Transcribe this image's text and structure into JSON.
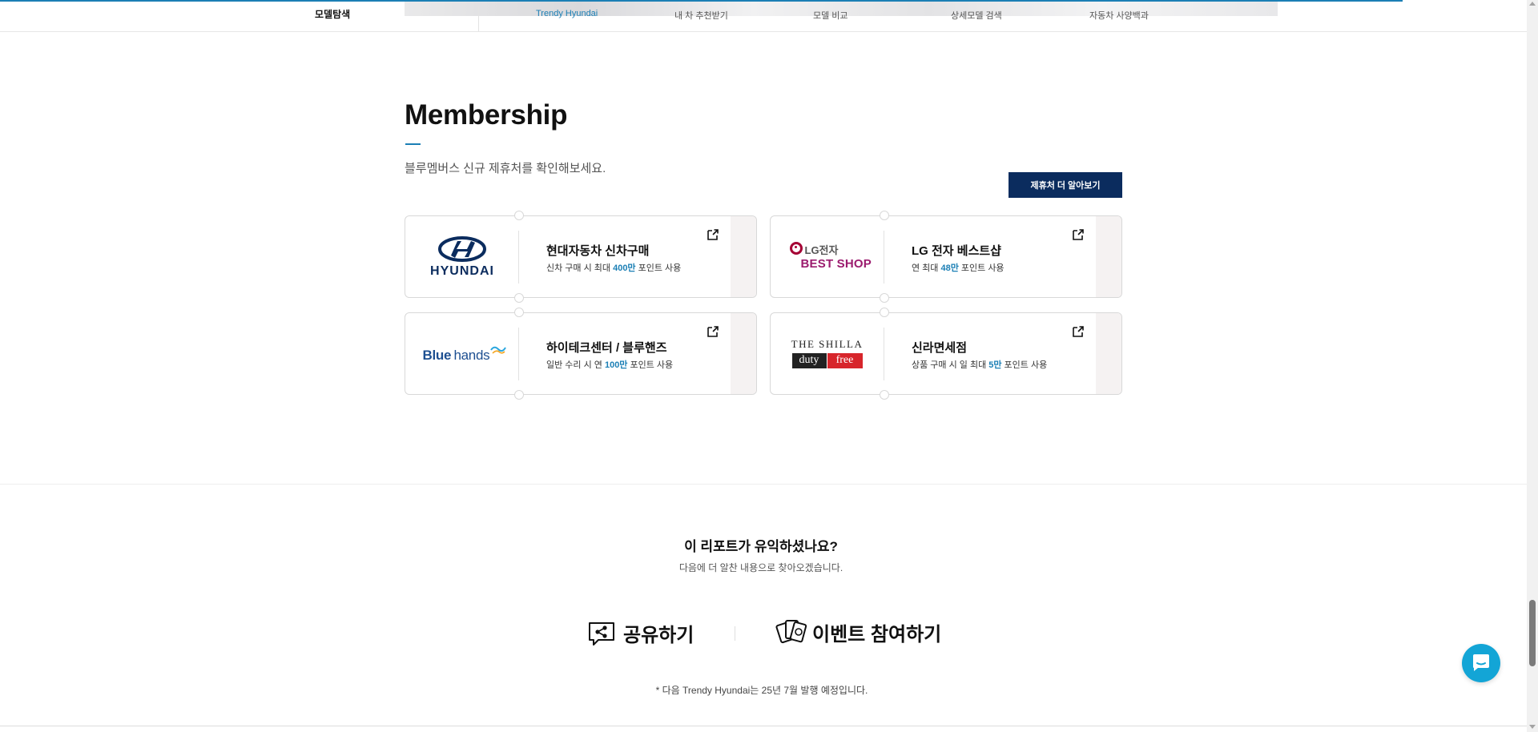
{
  "nav": {
    "brand": "모델탐색",
    "items": [
      {
        "label": "Trendy Hyundai",
        "active": true
      },
      {
        "label": "내 차 추천받기",
        "active": false
      },
      {
        "label": "모델 비교",
        "active": false
      },
      {
        "label": "상세모델 검색",
        "active": false
      },
      {
        "label": "자동차 사양백과",
        "active": false
      }
    ]
  },
  "membership": {
    "title": "Membership",
    "subtitle": "블루멤버스 신규 제휴처를 확인해보세요.",
    "more_button": "제휴처 더 알아보기",
    "cards": [
      {
        "logo": "HYUNDAI",
        "title": "현대자동차 신차구매",
        "desc_prefix": "신차 구매 시 최대 ",
        "desc_highlight": "400만",
        "desc_suffix": " 포인트 사용"
      },
      {
        "logo_top": "LG전자",
        "logo_bottom": "BEST SHOP",
        "title": "LG 전자 베스트샵",
        "desc_prefix": "연 최대 ",
        "desc_highlight": "48만",
        "desc_suffix": " 포인트 사용"
      },
      {
        "logo": "Bluehands",
        "logo_part1": "Blue",
        "logo_part2": "hands",
        "title": "하이테크센터 / 블루핸즈",
        "desc_prefix": "일반 수리 시 연 ",
        "desc_highlight": "100만",
        "desc_suffix": " 포인트 사용"
      },
      {
        "logo_top": "THE SHILLA",
        "logo_left": "duty",
        "logo_right": "free",
        "title": "신라면세점",
        "desc_prefix": "상품 구매 시 일 최대 ",
        "desc_highlight": "5만",
        "desc_suffix": " 포인트 사용"
      }
    ]
  },
  "feedback": {
    "question": "이 리포트가 유익하셨나요?",
    "answer": "다음에 더 알찬 내용으로 찾아오겠습니다.",
    "share_label": "공유하기",
    "event_label": "이벤트 참여하기",
    "note": "* 다음 Trendy Hyundai는 25년 7월 발행 예정입니다."
  },
  "colors": {
    "accent": "#1b7fb5",
    "navy_button": "#0b2c5e",
    "chat_button": "#13a5d6",
    "hyundai_logo": "#0b2c5e",
    "lg_red": "#a50034",
    "bestshop": "#9b1b6e",
    "shilla_red": "#d7252b"
  },
  "icons": {
    "external": "external-link-icon",
    "share": "share-icon",
    "event": "event-cards-icon",
    "chat": "chat-icon"
  }
}
